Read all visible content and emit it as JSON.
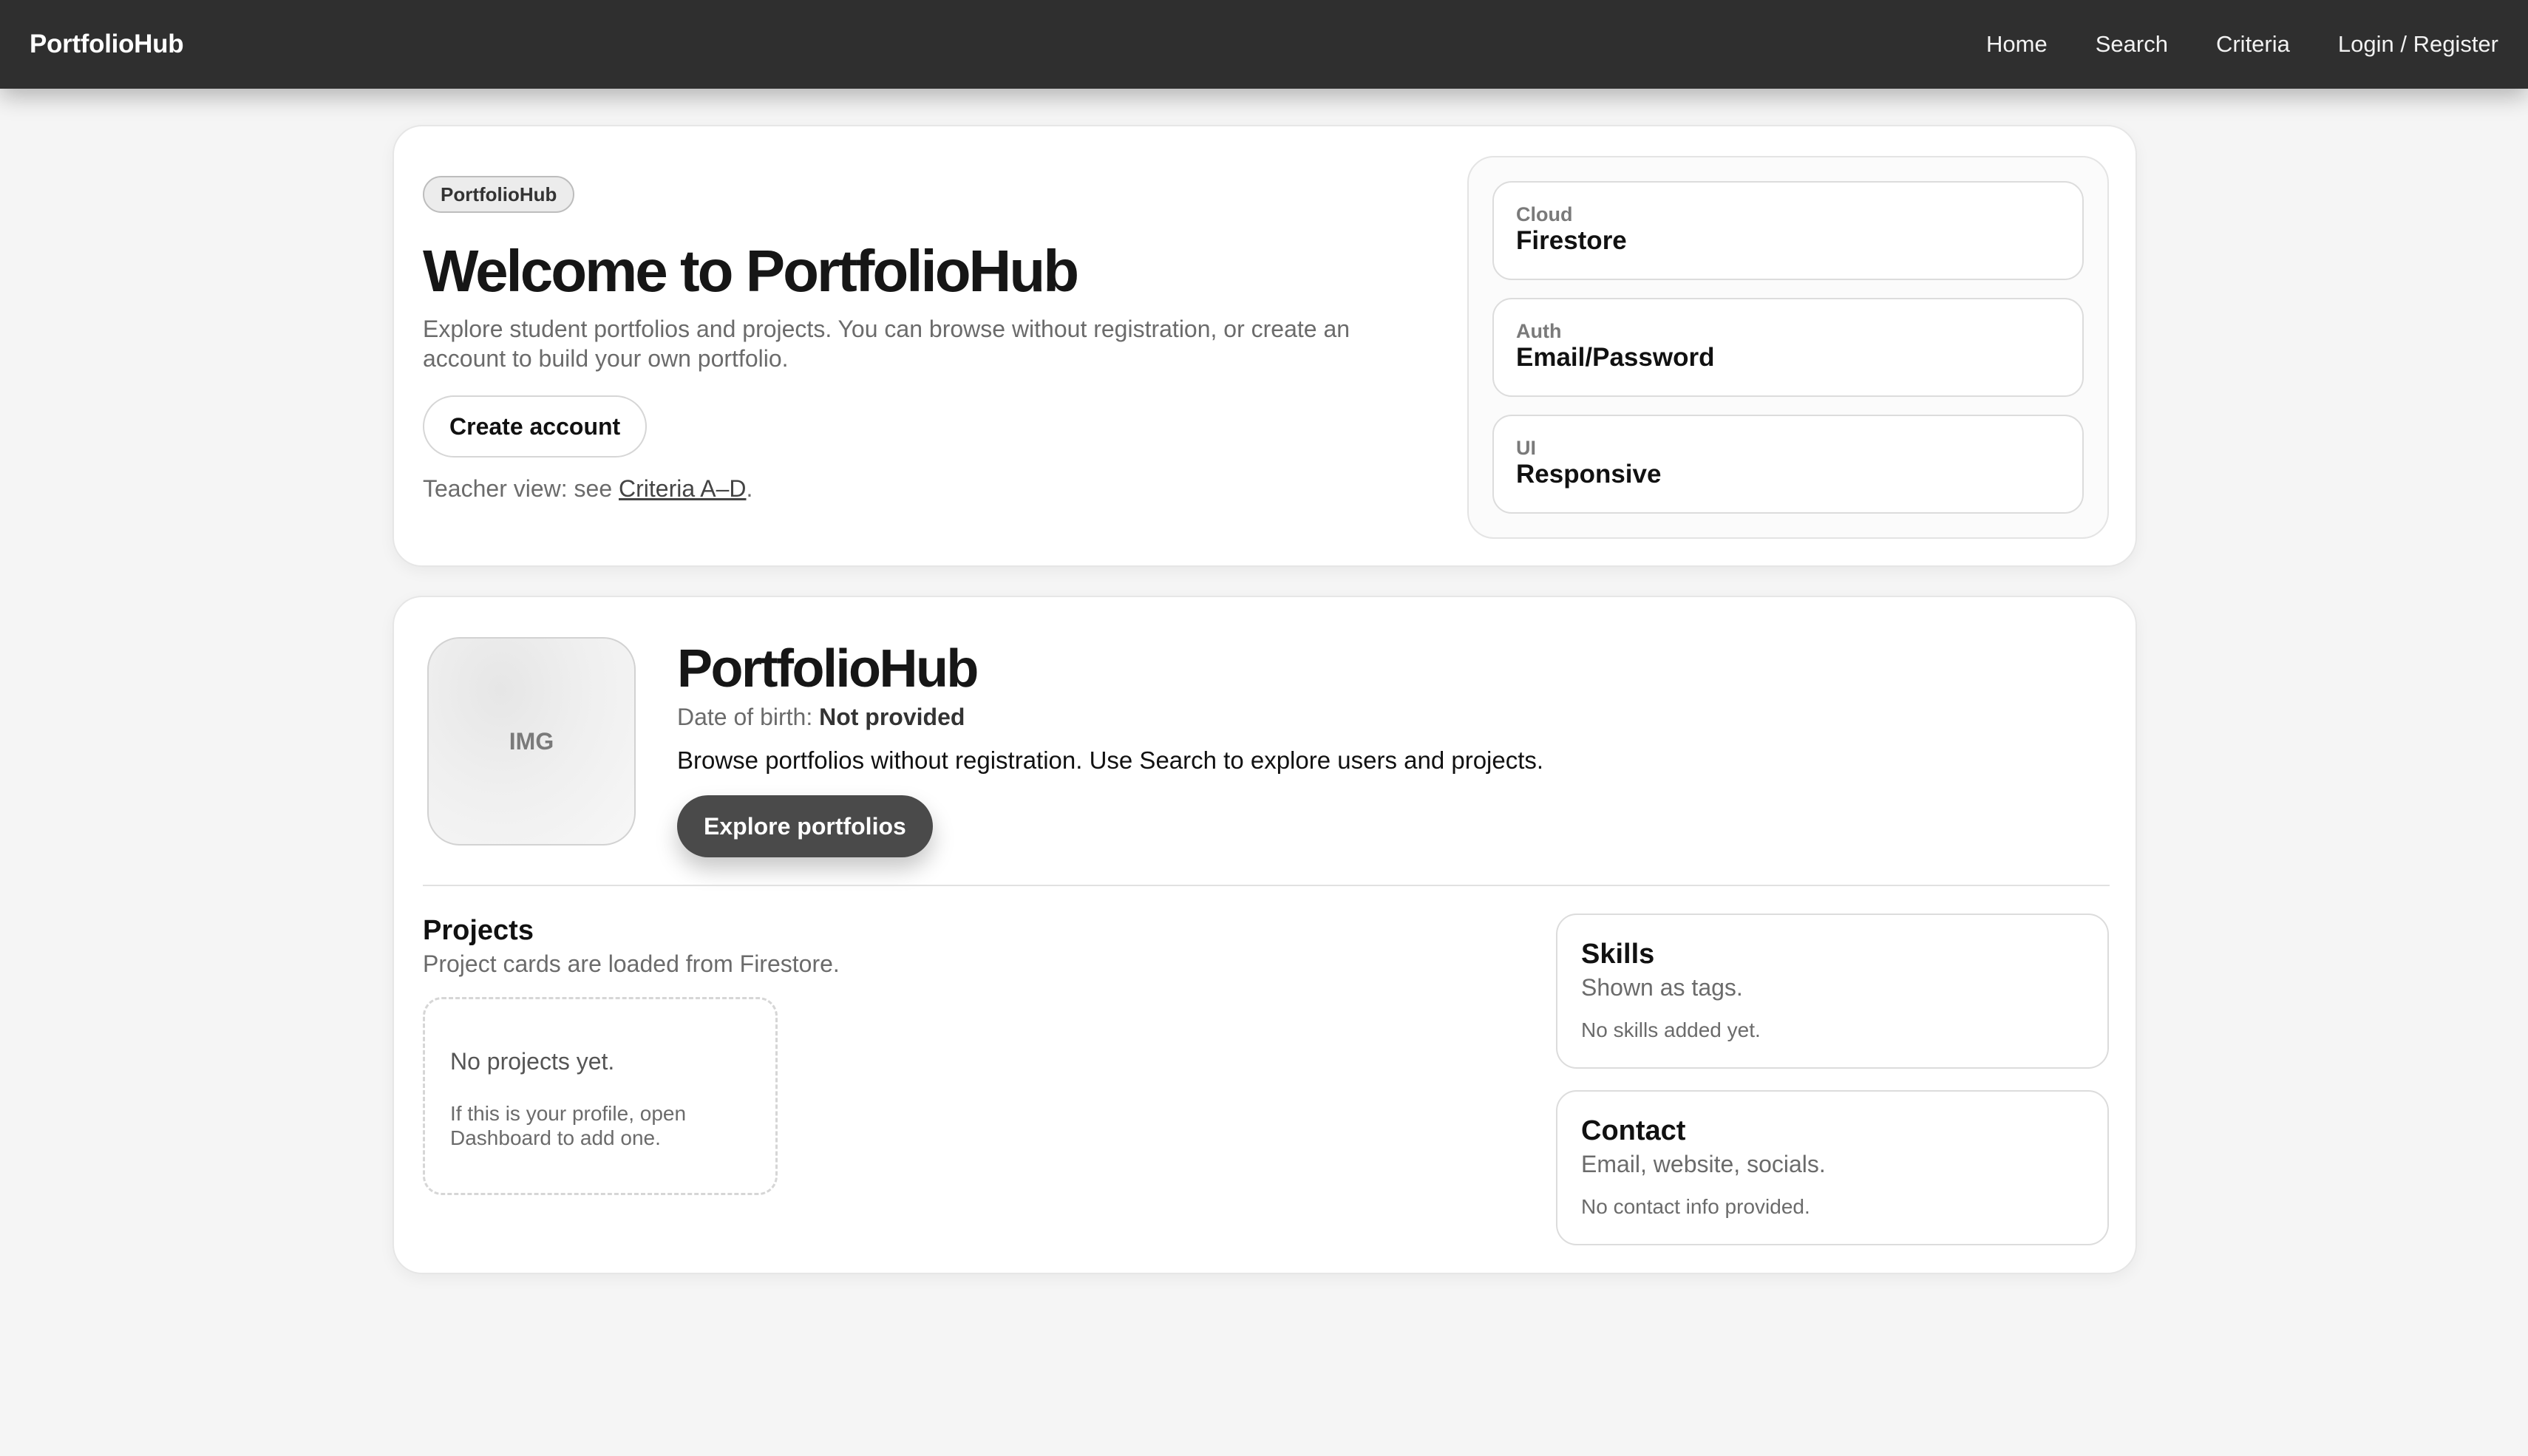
{
  "header": {
    "brand": "PortfolioHub",
    "nav": [
      "Home",
      "Search",
      "Criteria",
      "Login / Register"
    ]
  },
  "hero": {
    "pill": "PortfolioHub",
    "title": "Welcome to PortfolioHub",
    "subtitle": "Explore student portfolios and projects. You can browse without registration, or create an account to build your own portfolio.",
    "create_account": "Create account",
    "teacher_prefix": "Teacher view: see ",
    "teacher_link": "Criteria A–D",
    "teacher_suffix": ".",
    "tiles": [
      {
        "kicker": "Cloud",
        "value": "Firestore"
      },
      {
        "kicker": "Auth",
        "value": "Email/Password"
      },
      {
        "kicker": "UI",
        "value": "Responsive"
      }
    ]
  },
  "profile": {
    "avatar_label": "IMG",
    "name": "PortfolioHub",
    "dob_label": "Date of birth: ",
    "dob_value": "Not provided",
    "description": "Browse portfolios without registration. Use Search to explore users and projects.",
    "explore_button": "Explore portfolios",
    "projects": {
      "title": "Projects",
      "subtitle": "Project cards are loaded from Firestore.",
      "empty_title": "No projects yet.",
      "empty_note": "If this is your profile, open Dashboard to add one."
    },
    "skills": {
      "title": "Skills",
      "subtitle": "Shown as tags.",
      "note": "No skills added yet."
    },
    "contact": {
      "title": "Contact",
      "subtitle": "Email, website, socials.",
      "note": "No contact info provided."
    }
  },
  "colors": {
    "topbar": "#2f2f2f",
    "page_background": "#f5f5f5",
    "primary_button": "#4a4a4a"
  }
}
